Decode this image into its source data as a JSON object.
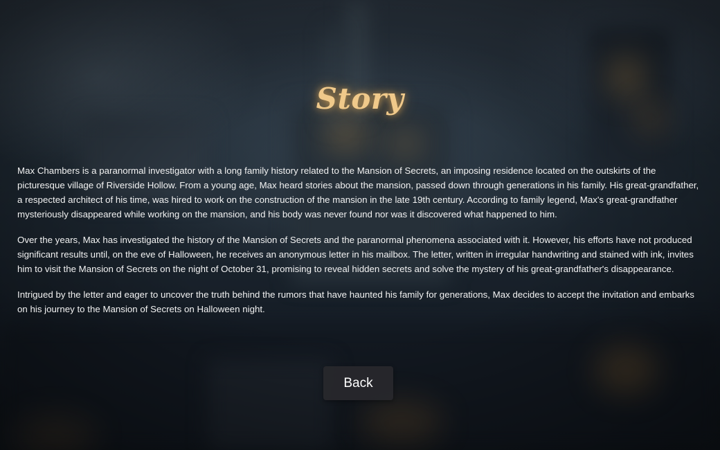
{
  "screen": {
    "title": "Story",
    "paragraphs": [
      "Max Chambers is a paranormal investigator with a long family history related to the Mansion of Secrets, an imposing residence located on the outskirts of the picturesque village of Riverside Hollow. From a young age, Max heard stories about the mansion, passed down through generations in his family. His great-grandfather, a respected architect of his time, was hired to work on the construction of the mansion in the late 19th century. According to family legend, Max's great-grandfather mysteriously disappeared while working on the mansion, and his body was never found nor was it discovered what happened to him.",
      "Over the years, Max has investigated the history of the Mansion of Secrets and the paranormal phenomena associated with it. However, his efforts have not produced significant results until, on the eve of Halloween, he receives an anonymous letter in his mailbox. The letter, written in irregular handwriting and stained with ink, invites him to visit the Mansion of Secrets on the night of October 31, promising to reveal hidden secrets and solve the mystery of his great-grandfather's disappearance.",
      "Intrigued by the letter and eager to uncover the truth behind the rumors that have haunted his family for generations, Max decides to accept the invitation and embarks on his journey to the Mansion of Secrets on Halloween night."
    ],
    "back_label": "Back"
  },
  "colors": {
    "title": "#f0c98a",
    "text": "#f2f2f2",
    "button_bg": "#28282c",
    "background": "#141a22"
  }
}
